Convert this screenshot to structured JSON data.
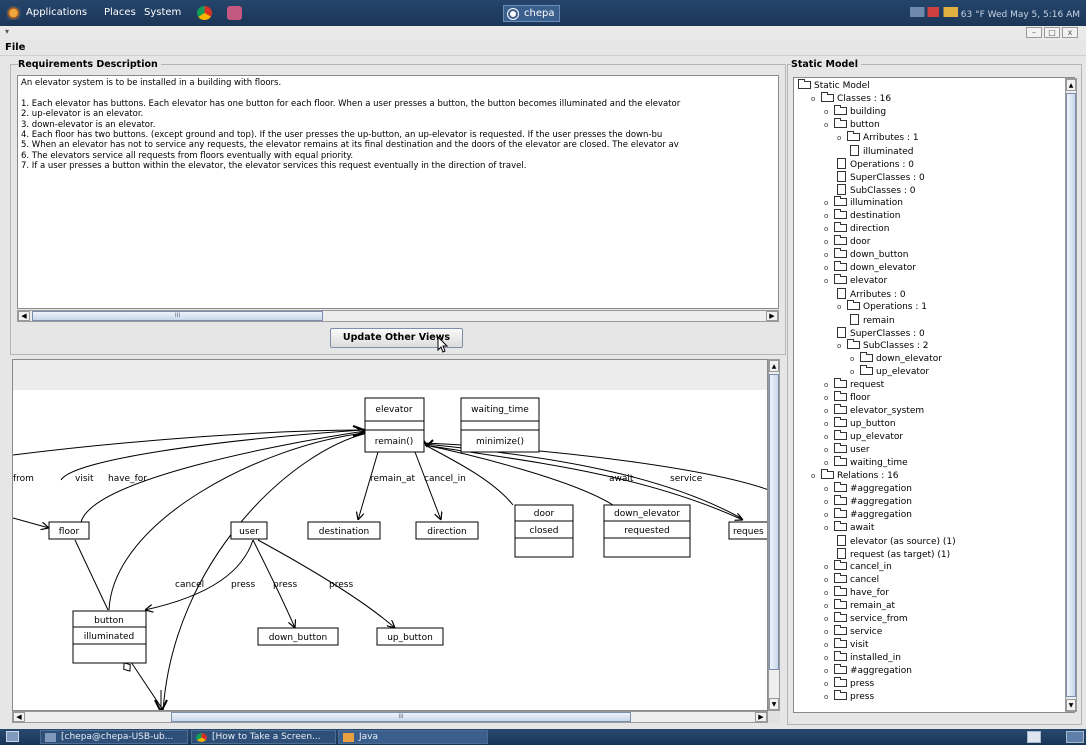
{
  "top_panel": {
    "menus": [
      "Applications",
      "Places",
      "System"
    ],
    "window_button": "chepa",
    "status": "63 °F  Wed May  5,  5:16 AM"
  },
  "menubar": {
    "file": "File"
  },
  "requirements": {
    "title": "Requirements Description",
    "lines": [
      "An elevator system is to be installed in a building with floors.",
      "",
      "  1. Each elevator has buttons. Each elevator has one button for each floor. When a user presses a button, the button becomes illuminated and the elevator",
      "  2. up-elevator is an elevator.",
      "  3. down-elevator is an elevator.",
      "  4. Each floor has two buttons. (except ground and top). If the user presses the up-button, an up-elevator is requested. If the user presses the down-bu",
      "  5. When an elevator has not to service any requests, the elevator remains at its final destination and the doors of the elevator are closed. The elevator av",
      "  6. The elevators service all requests from floors eventually with equal priority.",
      "  7. If a user presses a button within the elevator, the elevator services this request eventually in the direction of travel."
    ],
    "scroll_marker": "III",
    "update_button": "Update Other Views"
  },
  "diagram": {
    "classes": [
      {
        "id": "elevator",
        "name": "elevator",
        "attrs": [],
        "ops": [
          "remain()"
        ]
      },
      {
        "id": "waiting_time",
        "name": "waiting_time",
        "attrs": [],
        "ops": [
          "minimize()"
        ]
      },
      {
        "id": "floor",
        "name": "floor"
      },
      {
        "id": "destination",
        "name": "destination"
      },
      {
        "id": "direction",
        "name": "direction"
      },
      {
        "id": "door",
        "name": "door",
        "attrs": [
          "closed"
        ]
      },
      {
        "id": "down_elevator",
        "name": "down_elevator",
        "attrs": [
          "requested"
        ]
      },
      {
        "id": "request",
        "name": "reques"
      },
      {
        "id": "user",
        "name": "user"
      },
      {
        "id": "button",
        "name": "button",
        "attrs": [
          "illuminated"
        ]
      },
      {
        "id": "down_button",
        "name": "down_button"
      },
      {
        "id": "up_button",
        "name": "up_button"
      }
    ],
    "labels": [
      "from",
      "visit",
      "have_for",
      "remain_at",
      "cancel_in",
      "await",
      "service",
      "cancel",
      "press",
      "press",
      "press"
    ],
    "scroll_marker": "III"
  },
  "static_model": {
    "title": "Static Model",
    "tree": [
      {
        "d": 0,
        "t": "Static Model",
        "k": "folder",
        "tg": ""
      },
      {
        "d": 1,
        "t": "Classes : 16",
        "k": "folder",
        "tg": "open"
      },
      {
        "d": 2,
        "t": "building",
        "k": "folder",
        "tg": "closed"
      },
      {
        "d": 2,
        "t": "button",
        "k": "folder",
        "tg": "open"
      },
      {
        "d": 3,
        "t": "Arributes : 1",
        "k": "folder",
        "tg": "open"
      },
      {
        "d": 4,
        "t": "illuminated",
        "k": "leaf",
        "tg": ""
      },
      {
        "d": 3,
        "t": "Operations : 0",
        "k": "leaf",
        "tg": ""
      },
      {
        "d": 3,
        "t": "SuperClasses : 0",
        "k": "leaf",
        "tg": ""
      },
      {
        "d": 3,
        "t": "SubClasses : 0",
        "k": "leaf",
        "tg": ""
      },
      {
        "d": 2,
        "t": "illumination",
        "k": "folder",
        "tg": "closed"
      },
      {
        "d": 2,
        "t": "destination",
        "k": "folder",
        "tg": "closed"
      },
      {
        "d": 2,
        "t": "direction",
        "k": "folder",
        "tg": "closed"
      },
      {
        "d": 2,
        "t": "door",
        "k": "folder",
        "tg": "closed"
      },
      {
        "d": 2,
        "t": "down_button",
        "k": "folder",
        "tg": "closed"
      },
      {
        "d": 2,
        "t": "down_elevator",
        "k": "folder",
        "tg": "closed"
      },
      {
        "d": 2,
        "t": "elevator",
        "k": "folder",
        "tg": "open"
      },
      {
        "d": 3,
        "t": "Arributes : 0",
        "k": "leaf",
        "tg": ""
      },
      {
        "d": 3,
        "t": "Operations : 1",
        "k": "folder",
        "tg": "open"
      },
      {
        "d": 4,
        "t": "remain",
        "k": "leaf",
        "tg": ""
      },
      {
        "d": 3,
        "t": "SuperClasses : 0",
        "k": "leaf",
        "tg": ""
      },
      {
        "d": 3,
        "t": "SubClasses : 2",
        "k": "folder",
        "tg": "open"
      },
      {
        "d": 4,
        "t": "down_elevator",
        "k": "folder",
        "tg": "closed"
      },
      {
        "d": 4,
        "t": "up_elevator",
        "k": "folder",
        "tg": "closed"
      },
      {
        "d": 2,
        "t": "request",
        "k": "folder",
        "tg": "closed"
      },
      {
        "d": 2,
        "t": "floor",
        "k": "folder",
        "tg": "closed"
      },
      {
        "d": 2,
        "t": "elevator_system",
        "k": "folder",
        "tg": "closed"
      },
      {
        "d": 2,
        "t": "up_button",
        "k": "folder",
        "tg": "closed"
      },
      {
        "d": 2,
        "t": "up_elevator",
        "k": "folder",
        "tg": "closed"
      },
      {
        "d": 2,
        "t": "user",
        "k": "folder",
        "tg": "closed"
      },
      {
        "d": 2,
        "t": "waiting_time",
        "k": "folder",
        "tg": "closed"
      },
      {
        "d": 1,
        "t": "Relations : 16",
        "k": "folder",
        "tg": "open"
      },
      {
        "d": 2,
        "t": "#aggregation",
        "k": "folder",
        "tg": "closed"
      },
      {
        "d": 2,
        "t": "#aggregation",
        "k": "folder",
        "tg": "closed"
      },
      {
        "d": 2,
        "t": "#aggregation",
        "k": "folder",
        "tg": "closed"
      },
      {
        "d": 2,
        "t": "await",
        "k": "folder",
        "tg": "open"
      },
      {
        "d": 3,
        "t": "elevator (as source) (1)",
        "k": "leaf",
        "tg": ""
      },
      {
        "d": 3,
        "t": "request (as target) (1)",
        "k": "leaf",
        "tg": ""
      },
      {
        "d": 2,
        "t": "cancel_in",
        "k": "folder",
        "tg": "closed"
      },
      {
        "d": 2,
        "t": "cancel",
        "k": "folder",
        "tg": "closed"
      },
      {
        "d": 2,
        "t": "have_for",
        "k": "folder",
        "tg": "closed"
      },
      {
        "d": 2,
        "t": "remain_at",
        "k": "folder",
        "tg": "closed"
      },
      {
        "d": 2,
        "t": "service_from",
        "k": "folder",
        "tg": "closed"
      },
      {
        "d": 2,
        "t": "service",
        "k": "folder",
        "tg": "closed"
      },
      {
        "d": 2,
        "t": "visit",
        "k": "folder",
        "tg": "closed"
      },
      {
        "d": 2,
        "t": "installed_in",
        "k": "folder",
        "tg": "closed"
      },
      {
        "d": 2,
        "t": "#aggregation",
        "k": "folder",
        "tg": "closed"
      },
      {
        "d": 2,
        "t": "press",
        "k": "folder",
        "tg": "closed"
      },
      {
        "d": 2,
        "t": "press",
        "k": "folder",
        "tg": "closed"
      }
    ]
  },
  "taskbar": {
    "tasks": [
      "[chepa@chepa-USB-ub...",
      "[How to Take a Screen...",
      "Java"
    ]
  }
}
